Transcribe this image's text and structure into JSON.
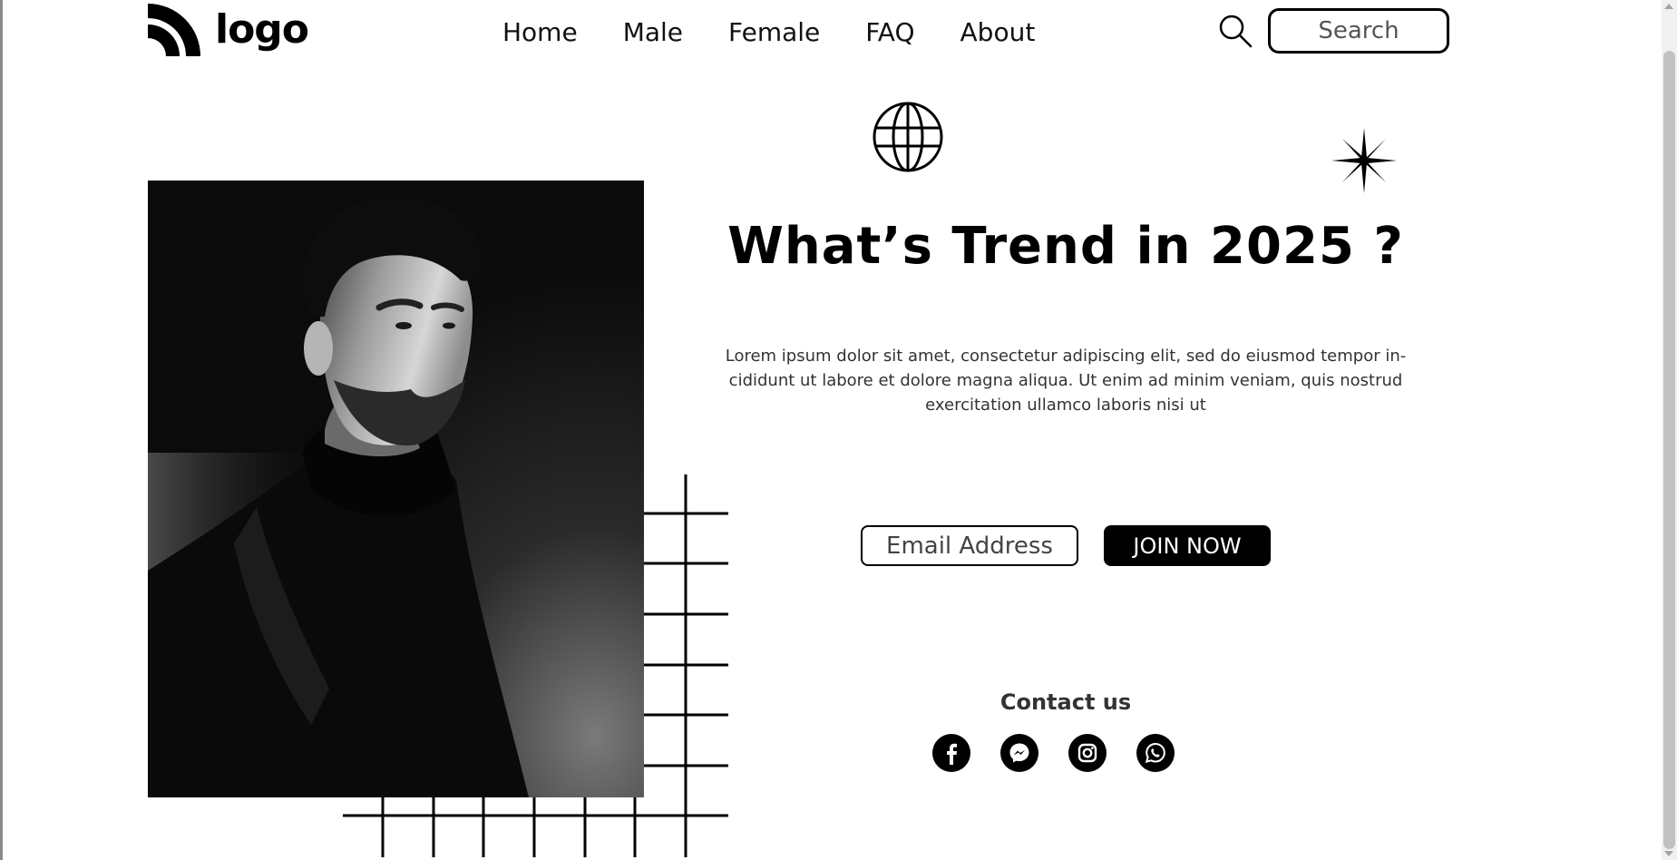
{
  "header": {
    "logo_text": "logo",
    "nav": [
      "Home",
      "Male",
      "Female",
      "FAQ",
      "About"
    ],
    "search_placeholder": "Search"
  },
  "hero": {
    "headline": "What’s Trend in 2025 ?",
    "description": "Lorem ipsum dolor sit amet, consectetur adipiscing elit, sed do eiusmod tempor in-cididunt ut labore et dolore magna aliqua. Ut enim ad minim veniam, quis nostrud exercitation ullamco laboris nisi ut",
    "email_placeholder": "Email Address",
    "join_label": "JOIN NOW"
  },
  "contact": {
    "title": "Contact us",
    "socials": [
      "facebook-icon",
      "messenger-icon",
      "instagram-icon",
      "whatsapp-icon"
    ]
  },
  "colors": {
    "background": "#ffffff",
    "primary": "#000000",
    "text_muted": "#333333"
  }
}
